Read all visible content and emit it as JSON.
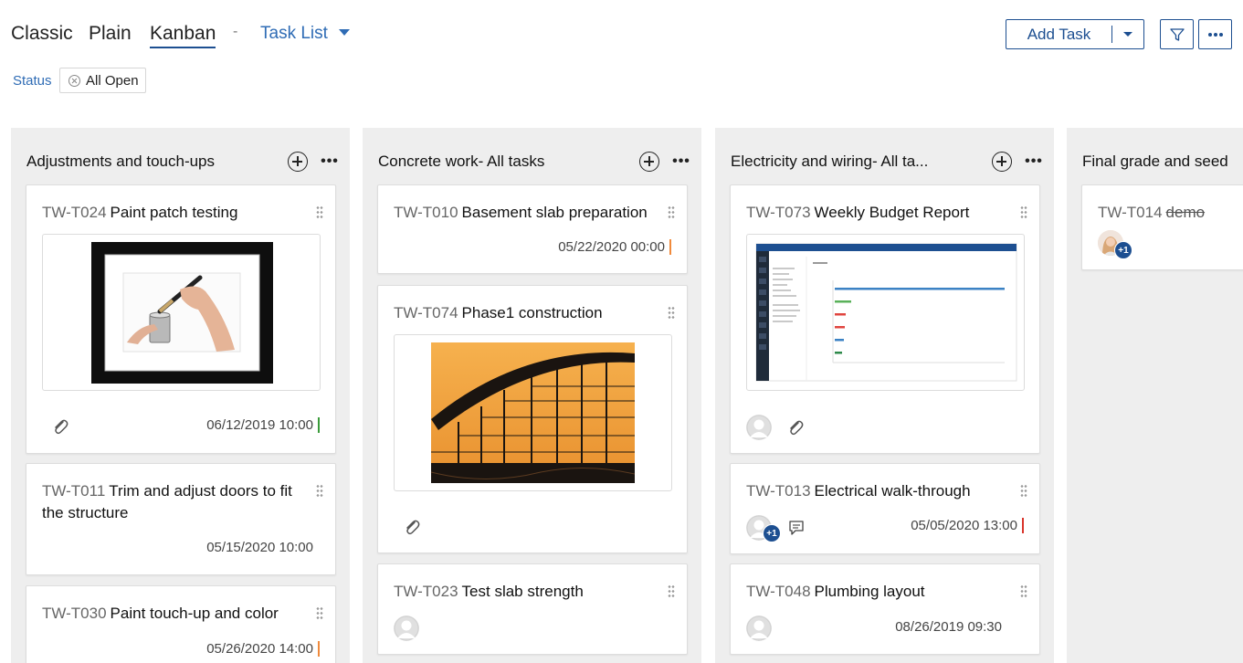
{
  "views": {
    "classic": "Classic",
    "plain": "Plain",
    "kanban": "Kanban",
    "separator": "-",
    "task_list": "Task List"
  },
  "toolbar": {
    "add_task": "Add Task"
  },
  "filter": {
    "status_label": "Status",
    "status_value": "All Open"
  },
  "colors": {
    "primary": "#1d4f91",
    "link": "#2f6cb5",
    "priority_green": "#3a9b3a",
    "priority_orange": "#f08a3c",
    "priority_red": "#d9342b"
  },
  "columns": [
    {
      "title": "Adjustments and touch-ups",
      "cards": [
        {
          "id": "TW-T024",
          "title": "Paint patch testing",
          "date": "06/12/2019 10:00",
          "priority": "green"
        },
        {
          "id": "TW-T011",
          "title": "Trim and adjust doors to fit the structure",
          "date": "05/15/2020 10:00",
          "priority": "none"
        },
        {
          "id": "TW-T030",
          "title": "Paint touch-up and color",
          "date": "05/26/2020 14:00",
          "priority": "orange"
        }
      ]
    },
    {
      "title": "Concrete work- All tasks",
      "cards": [
        {
          "id": "TW-T010",
          "title": "Basement slab preparation",
          "date": "05/22/2020 00:00",
          "priority": "orange"
        },
        {
          "id": "TW-T074",
          "title": "Phase1 construction"
        },
        {
          "id": "TW-T023",
          "title": "Test slab strength"
        }
      ]
    },
    {
      "title": "Electricity and wiring- All ta...",
      "cards": [
        {
          "id": "TW-T073",
          "title": "Weekly Budget Report"
        },
        {
          "id": "TW-T013",
          "title": "Electrical walk-through",
          "date": "05/05/2020 13:00",
          "priority": "red",
          "extra_assignees": "+1"
        },
        {
          "id": "TW-T048",
          "title": "Plumbing layout",
          "date": "08/26/2019 09:30",
          "priority": "none"
        }
      ]
    },
    {
      "title": "Final grade and seed",
      "cards": [
        {
          "id": "TW-T014",
          "title": "demo",
          "extra_assignees": "+1"
        }
      ]
    }
  ]
}
